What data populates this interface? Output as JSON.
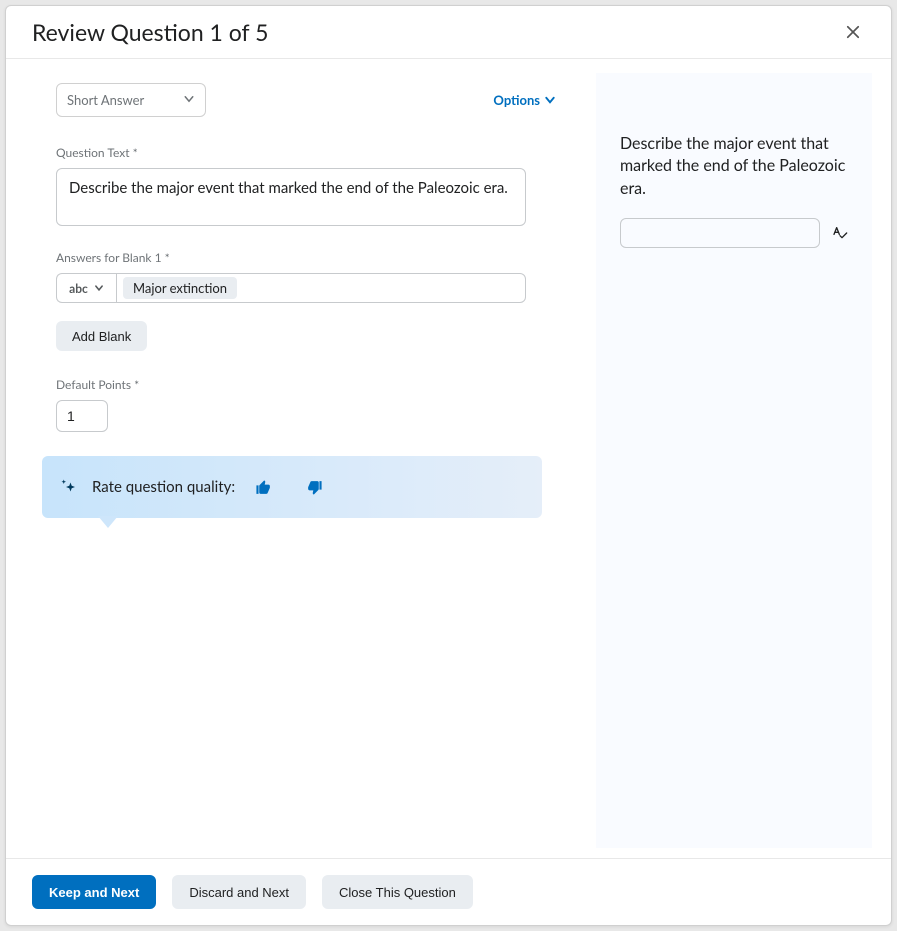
{
  "header": {
    "title": "Review Question 1 of 5"
  },
  "left": {
    "question_type": "Short Answer",
    "options_label": "Options",
    "question_text_label": "Question Text *",
    "question_text": "Describe the major event that marked the end of the Paleozoic era.",
    "answers_label": "Answers for Blank 1 *",
    "compare_mode": "abc",
    "answer_chip": "Major extinction",
    "add_blank_label": "Add Blank",
    "default_points_label": "Default Points *",
    "default_points_value": "1",
    "rate_label": "Rate question quality:"
  },
  "preview": {
    "question_text": "Describe the major event that marked the end of the Paleozoic era."
  },
  "footer": {
    "keep_label": "Keep and Next",
    "discard_label": "Discard and Next",
    "close_label": "Close This Question"
  }
}
